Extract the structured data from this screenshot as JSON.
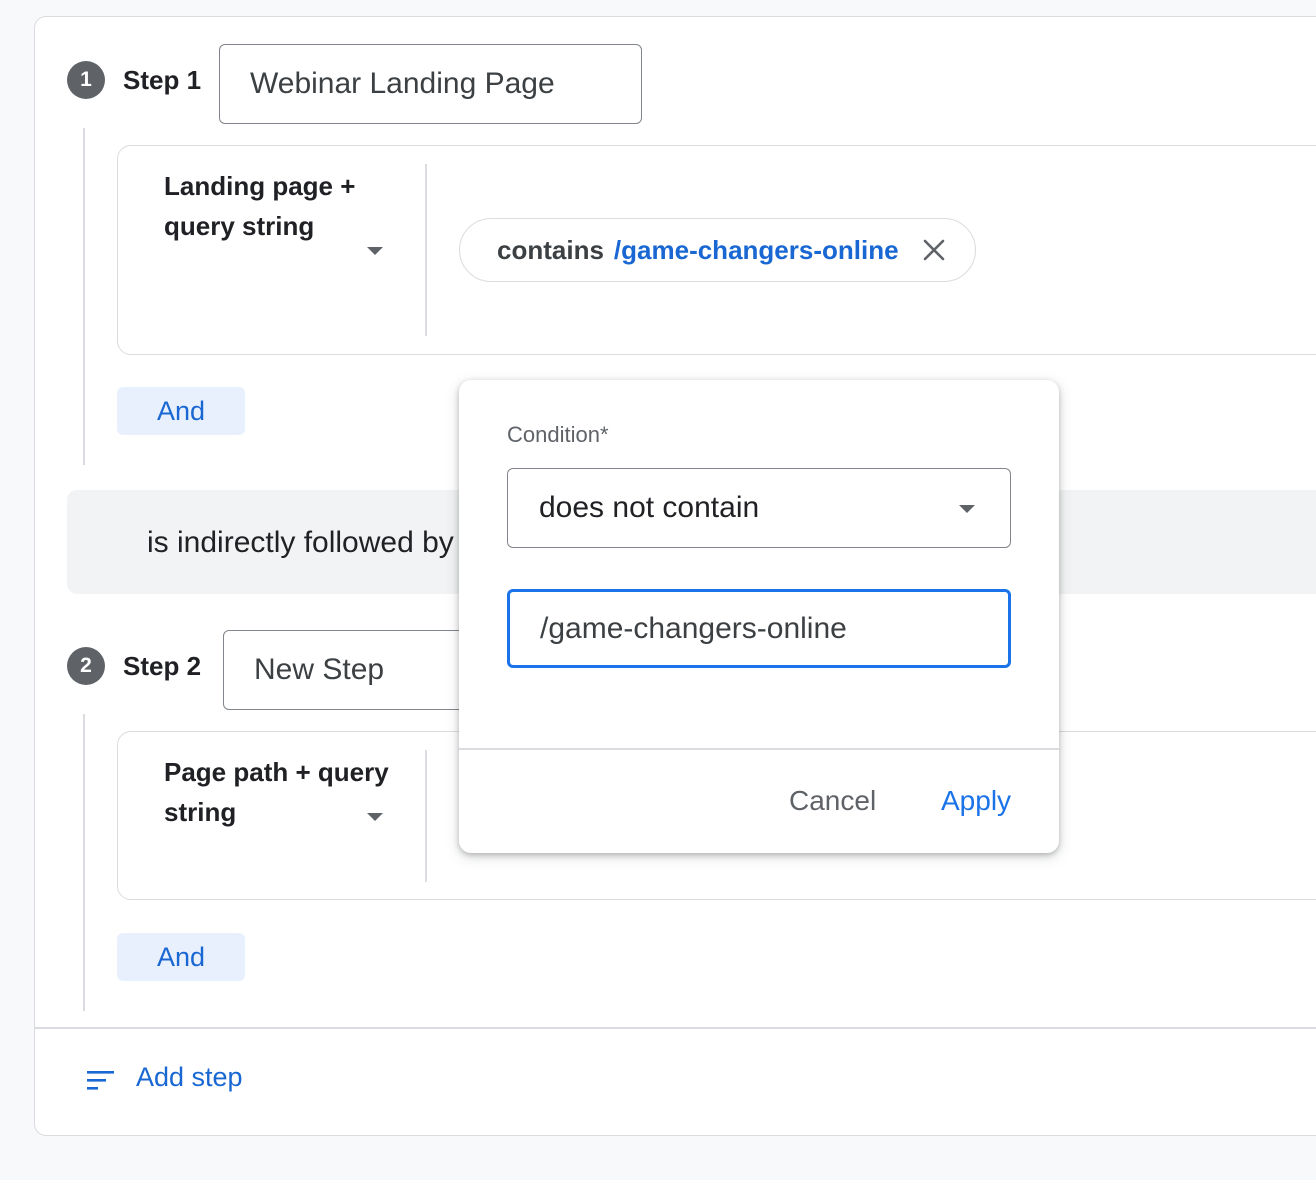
{
  "steps": [
    {
      "number": "1",
      "label": "Step 1",
      "name": "Webinar Landing Page",
      "dimension": "Landing page + query string",
      "condition_chip": {
        "operator": "contains",
        "value": "/game-changers-online"
      },
      "and_label": "And"
    },
    {
      "number": "2",
      "label": "Step 2",
      "name": "New Step",
      "dimension": "Page path + query string",
      "and_label": "And"
    }
  ],
  "between_steps": "is indirectly followed by",
  "add_step_label": "Add step",
  "popup": {
    "condition_label": "Condition*",
    "condition_selected": "does not contain",
    "value_input": "/game-changers-online",
    "cancel_label": "Cancel",
    "apply_label": "Apply"
  },
  "icons": {
    "chip_remove": "close-icon",
    "add_step": "sort-lines-icon",
    "dropdown": "caret-down-icon"
  },
  "colors": {
    "accent_blue": "#1a73e8",
    "chip_value_blue": "#1967d2",
    "and_button_bg": "#e8f0fe",
    "badge_gray": "#5f6368"
  }
}
